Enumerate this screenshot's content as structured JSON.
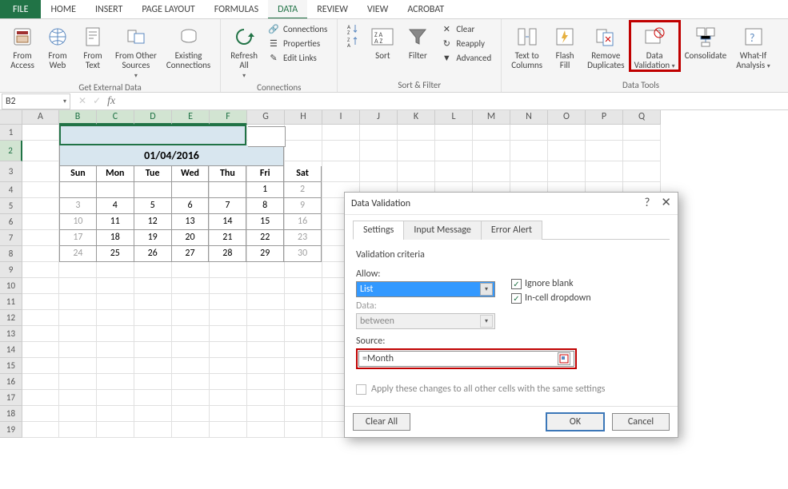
{
  "ribbon": {
    "tabs": [
      "FILE",
      "HOME",
      "INSERT",
      "PAGE LAYOUT",
      "FORMULAS",
      "DATA",
      "REVIEW",
      "VIEW",
      "ACROBAT"
    ],
    "active_tab": "DATA",
    "groups": {
      "external": {
        "label": "Get External Data",
        "btns": [
          {
            "line1": "From",
            "line2": "Access"
          },
          {
            "line1": "From",
            "line2": "Web"
          },
          {
            "line1": "From",
            "line2": "Text"
          },
          {
            "line1": "From Other",
            "line2": "Sources"
          },
          {
            "line1": "Existing",
            "line2": "Connections"
          }
        ]
      },
      "connections": {
        "label": "Connections",
        "refresh": {
          "line1": "Refresh",
          "line2": "All"
        },
        "items": [
          "Connections",
          "Properties",
          "Edit Links"
        ]
      },
      "sortfilter": {
        "label": "Sort & Filter",
        "sort": "Sort",
        "filter": "Filter",
        "items": [
          "Clear",
          "Reapply",
          "Advanced"
        ]
      },
      "datatools": {
        "label": "Data Tools",
        "btns": [
          {
            "line1": "Text to",
            "line2": "Columns"
          },
          {
            "line1": "Flash",
            "line2": "Fill"
          },
          {
            "line1": "Remove",
            "line2": "Duplicates"
          },
          {
            "line1": "Data",
            "line2": "Validation"
          },
          {
            "line1": "Consolidate",
            "line2": ""
          },
          {
            "line1": "What-If",
            "line2": "Analysis"
          }
        ]
      }
    }
  },
  "namebox": "B2",
  "fx": "fx",
  "columns": [
    "A",
    "B",
    "C",
    "D",
    "E",
    "F",
    "G",
    "H",
    "I",
    "J",
    "K",
    "L",
    "M",
    "N",
    "O",
    "P",
    "Q"
  ],
  "selected_cols": [
    "B",
    "C",
    "D",
    "E",
    "F"
  ],
  "selected_row": 2,
  "row_count": 19,
  "calendar": {
    "date": "01/04/2016",
    "days": [
      "Sun",
      "Mon",
      "Tue",
      "Wed",
      "Thu",
      "Fri",
      "Sat"
    ],
    "rows": [
      [
        "",
        "",
        "",
        "",
        "",
        "1",
        "2"
      ],
      [
        "3",
        "4",
        "5",
        "6",
        "7",
        "8",
        "9"
      ],
      [
        "10",
        "11",
        "12",
        "13",
        "14",
        "15",
        "16"
      ],
      [
        "17",
        "18",
        "19",
        "20",
        "21",
        "22",
        "23"
      ],
      [
        "24",
        "25",
        "26",
        "27",
        "28",
        "29",
        "30"
      ]
    ],
    "grey": [
      [],
      [
        0,
        6
      ],
      [
        0,
        6
      ],
      [
        0,
        6
      ],
      [
        0,
        6
      ],
      [
        0,
        6
      ]
    ],
    "grey_first": [
      6
    ]
  },
  "dialog": {
    "title": "Data Validation",
    "tabs": [
      "Settings",
      "Input Message",
      "Error Alert"
    ],
    "active_tab": "Settings",
    "section": "Validation criteria",
    "allow_label": "Allow:",
    "allow_value": "List",
    "data_label": "Data:",
    "data_value": "between",
    "ignore_blank": "Ignore blank",
    "incell": "In-cell dropdown",
    "source_label": "Source:",
    "source_value": "=Month",
    "apply_all": "Apply these changes to all other cells with the same settings",
    "clear": "Clear All",
    "ok": "OK",
    "cancel": "Cancel",
    "help": "?",
    "close": "✕"
  }
}
